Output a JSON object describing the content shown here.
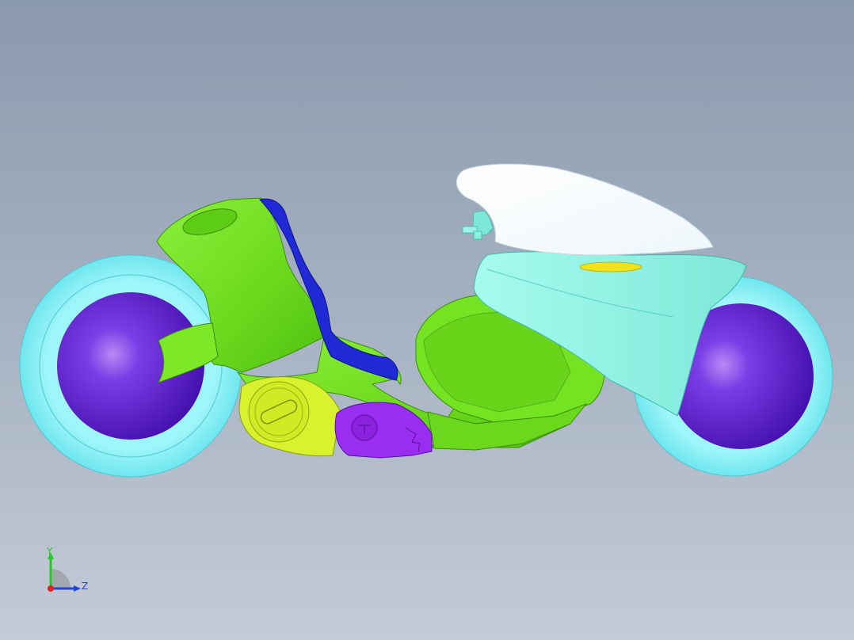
{
  "viewport": {
    "background_top": "#8a99ad",
    "background_bottom": "#c3cbd6"
  },
  "model": {
    "part_colors": {
      "tire": "#8ff3f7",
      "wheel_hub": "#5a16c8",
      "frame": "#6fe41a",
      "seat": "#1a22c8",
      "engine_cover_left": "#d6f02a",
      "engine_cover_right": "#9a2ef0",
      "rear_fairing": "#8ff3e6",
      "rear_fairing_top": "#ffffff",
      "tail_light": "#f2e21a",
      "mirror": "#7ee8d8"
    }
  },
  "triad": {
    "y_label": "Y",
    "z_label": "Z",
    "y_color": "#22cc22",
    "z_color": "#2244dd",
    "x_color": "#dd2222"
  }
}
